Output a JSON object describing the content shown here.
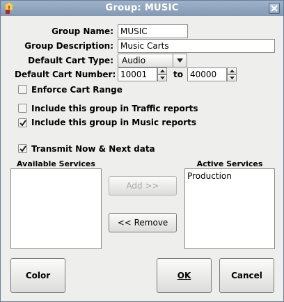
{
  "window": {
    "title": "Group: MUSIC"
  },
  "form": {
    "group_name": {
      "label": "Group Name:",
      "value": "MUSIC"
    },
    "group_description": {
      "label": "Group Description:",
      "value": "Music Carts"
    },
    "default_cart_type": {
      "label": "Default Cart Type:",
      "value": "Audio"
    },
    "default_cart_number": {
      "label": "Default Cart Number:",
      "from": "10001",
      "to_label": "to",
      "to": "40000"
    }
  },
  "checkboxes": {
    "enforce_cart_range": {
      "label": "Enforce Cart Range",
      "checked": false
    },
    "traffic_reports": {
      "label": "Include this group in Traffic reports",
      "checked": false
    },
    "music_reports": {
      "label": "Include this group in Music reports",
      "checked": true
    },
    "transmit_now_next": {
      "label": "Transmit Now & Next data",
      "checked": true
    }
  },
  "services": {
    "available_label": "Available Services",
    "available_items": [],
    "active_label": "Active Services",
    "active_items": [
      "Production"
    ],
    "add_label": "Add >>",
    "remove_label": "<< Remove"
  },
  "buttons": {
    "color": "Color",
    "ok": "OK",
    "cancel": "Cancel"
  },
  "icons": {
    "app": "rivendell-flower-icon",
    "close": "close-icon",
    "check": "check-icon",
    "dropdown": "chevron-down-icon",
    "spin_up": "spin-up-icon",
    "spin_down": "spin-down-icon"
  }
}
